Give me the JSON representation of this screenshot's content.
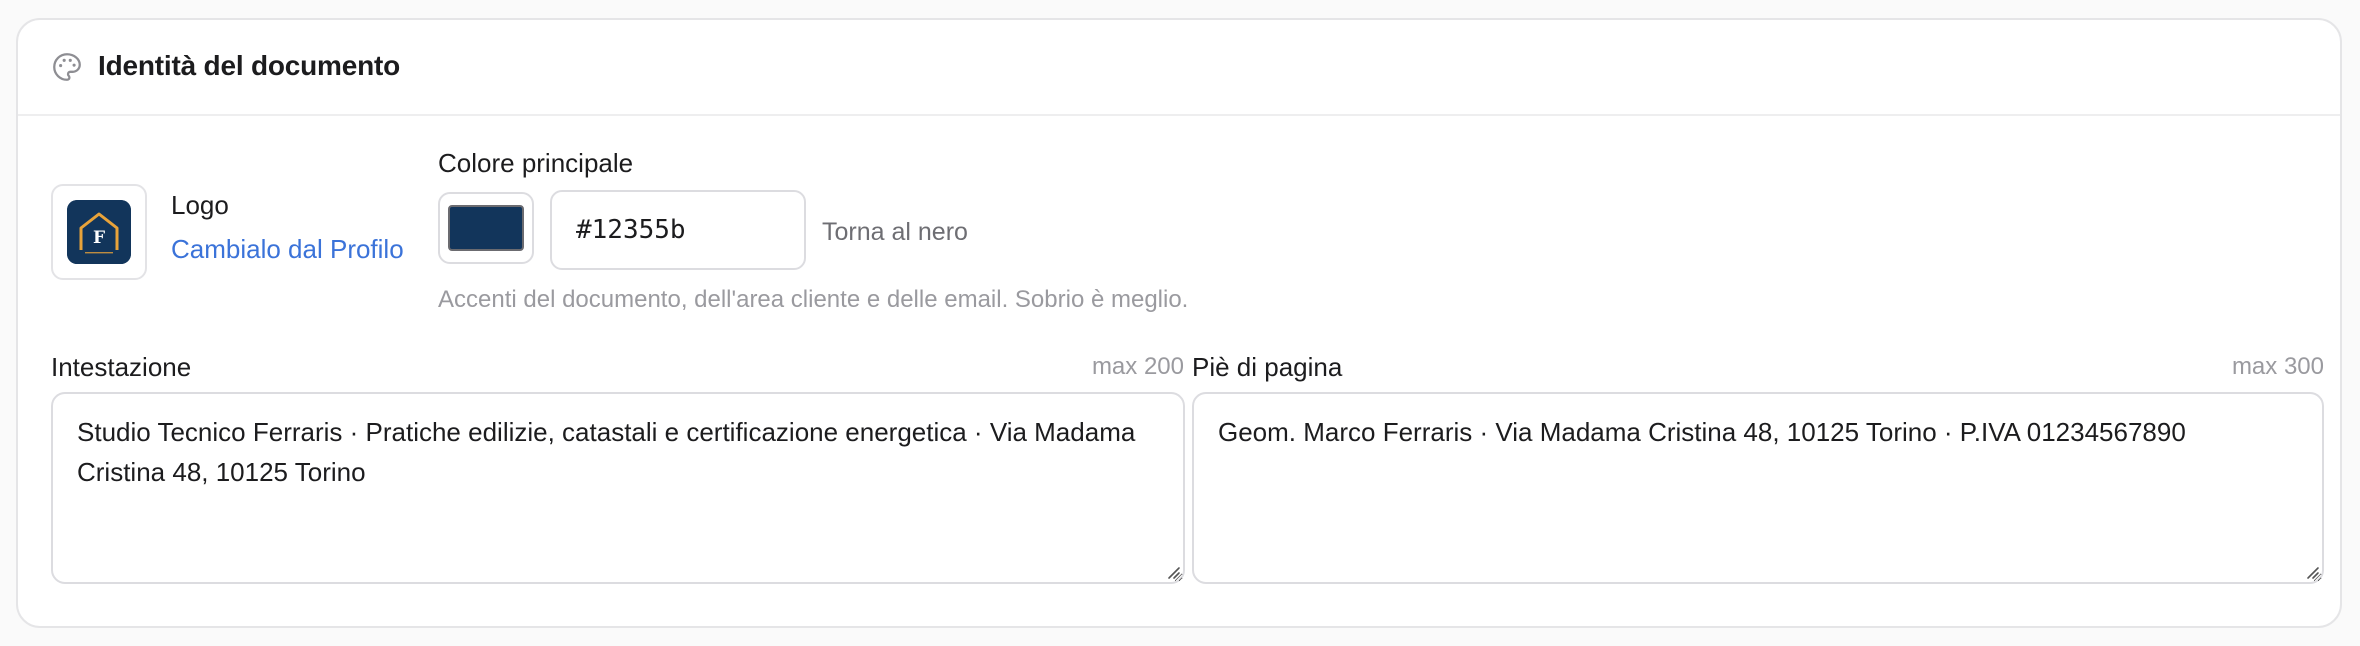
{
  "card": {
    "title": "Identità del documento",
    "icon": "palette-icon"
  },
  "logo": {
    "label": "Logo",
    "change_link": "Cambialo dal Profilo",
    "letter": "F",
    "icon": "house-logo-icon"
  },
  "color": {
    "label": "Colore principale",
    "value": "#12355b",
    "reset_label": "Torna al nero",
    "help": "Accenti del documento, dell'area cliente e delle email. Sobrio è meglio."
  },
  "header_field": {
    "label": "Intestazione",
    "max": "max 200",
    "value": "Studio Tecnico Ferraris · Pratiche edilizie, catastali e certificazione energetica · Via Madama Cristina 48, 10125 Torino"
  },
  "footer_field": {
    "label": "Piè di pagina",
    "max": "max 300",
    "value": "Geom. Marco Ferraris · Via Madama Cristina 48, 10125 Torino · P.IVA 01234567890"
  },
  "colors": {
    "brand": "#12355b",
    "link": "#3b73d9",
    "logo_accent": "#e8a33a"
  }
}
